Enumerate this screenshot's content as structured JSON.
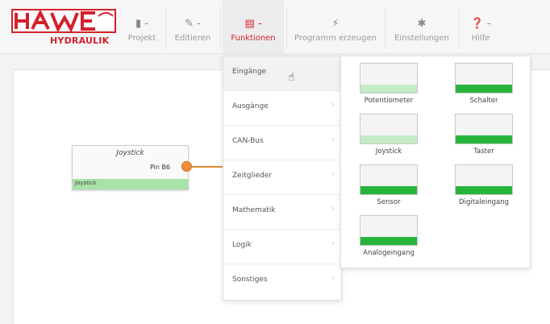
{
  "brand": {
    "logo_text": "HAWE",
    "sub_text": "HYDRAULIK"
  },
  "colors": {
    "brand_red": "#d4202c",
    "accent_green": "#28b43c",
    "light_green": "#c4ecc4",
    "connector_orange": "#f08c3c"
  },
  "toolbar": {
    "items": [
      {
        "icon": "file-icon",
        "glyph": "▮ -",
        "label": "Projekt",
        "active": false
      },
      {
        "icon": "pencil-icon",
        "glyph": "✎ -",
        "label": "Editieren",
        "active": false
      },
      {
        "icon": "functions-icon",
        "glyph": "▤ -",
        "label": "Funktionen",
        "active": true
      },
      {
        "icon": "bolt-icon",
        "glyph": "⚡",
        "label": "Programm erzeugen",
        "active": false
      },
      {
        "icon": "gear-icon",
        "glyph": "✱",
        "label": "Einstellungen",
        "active": false
      },
      {
        "icon": "help-icon",
        "glyph": "❓ -",
        "label": "Hilfe",
        "active": false
      }
    ]
  },
  "node": {
    "title": "Joystick",
    "pin": "Pin B6",
    "bar_label": "Joystick"
  },
  "menu": {
    "items": [
      {
        "label": "Eingänge",
        "chevron": ""
      },
      {
        "label": "Ausgänge",
        "chevron": "›"
      },
      {
        "label": "CAN-Bus",
        "chevron": "›"
      },
      {
        "label": "Zeitglieder",
        "chevron": "›"
      },
      {
        "label": "Mathematik",
        "chevron": "›"
      },
      {
        "label": "Logik",
        "chevron": "›"
      },
      {
        "label": "Sonstiges",
        "chevron": "›"
      }
    ]
  },
  "submenu": {
    "blocks": [
      {
        "label": "Potentiometer",
        "fill": "light"
      },
      {
        "label": "Schalter",
        "fill": "dark"
      },
      {
        "label": "Joystick",
        "fill": "light"
      },
      {
        "label": "Taster",
        "fill": "dark"
      },
      {
        "label": "Sensor",
        "fill": "dark"
      },
      {
        "label": "Digitaleingang",
        "fill": "dark"
      },
      {
        "label": "Analogeingang",
        "fill": "dark"
      }
    ]
  }
}
